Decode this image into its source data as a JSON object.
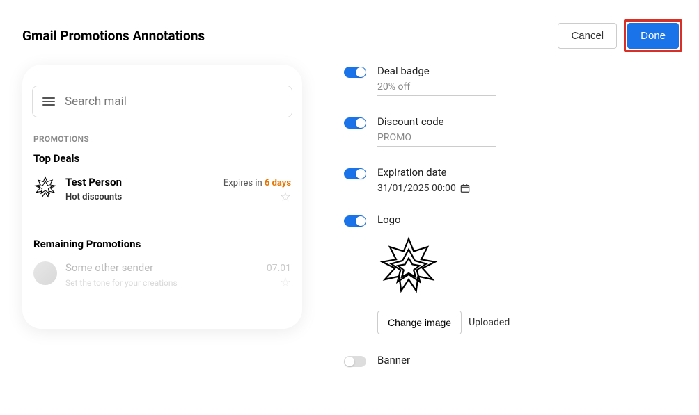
{
  "header": {
    "title": "Gmail Promotions Annotations",
    "cancel_label": "Cancel",
    "done_label": "Done"
  },
  "preview": {
    "search_placeholder": "Search mail",
    "promotions_label": "PROMOTIONS",
    "top_deals_label": "Top Deals",
    "sender": "Test Person",
    "expires_prefix": "Expires in ",
    "expires_days": "6 days",
    "subject": "Hot discounts",
    "remaining_label": "Remaining Promotions",
    "other_sender": "Some other sender",
    "other_date": "07.01",
    "other_sub": "Set the tone for your creations"
  },
  "settings": {
    "deal_badge": {
      "label": "Deal badge",
      "value": "20% off",
      "enabled": true
    },
    "discount_code": {
      "label": "Discount code",
      "value": "PROMO",
      "enabled": true
    },
    "expiration": {
      "label": "Expiration date",
      "value": "31/01/2025 00:00",
      "enabled": true
    },
    "logo": {
      "label": "Logo",
      "change_label": "Change image",
      "status": "Uploaded",
      "enabled": true
    },
    "banner": {
      "label": "Banner",
      "enabled": false
    }
  }
}
